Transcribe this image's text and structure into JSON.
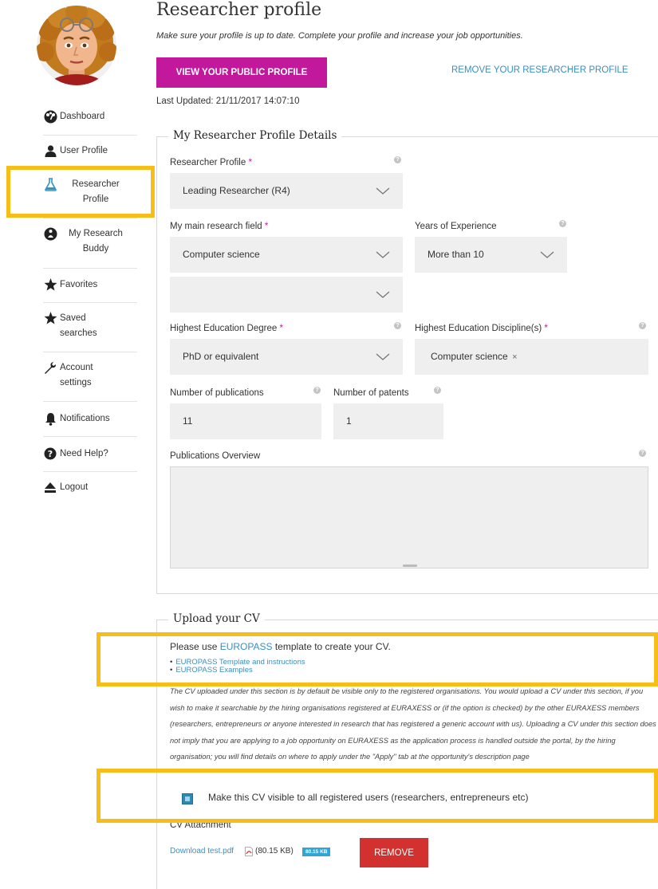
{
  "sidebar": {
    "items": [
      {
        "label": "Dashboard",
        "icon": "dashboard-icon"
      },
      {
        "label": "User Profile",
        "icon": "user-icon"
      },
      {
        "label": "Researcher Profile",
        "icon": "flask-icon"
      },
      {
        "label": "My Research Buddy",
        "icon": "globe-person-icon"
      },
      {
        "label": "Favorites",
        "icon": "star-icon"
      },
      {
        "label": "Saved searches",
        "icon": "star-icon"
      },
      {
        "label": "Account settings",
        "icon": "wrench-icon"
      },
      {
        "label": "Notifications",
        "icon": "bell-icon"
      },
      {
        "label": "Need Help?",
        "icon": "question-icon"
      },
      {
        "label": "Logout",
        "icon": "eject-icon"
      }
    ],
    "active": "Researcher Profile"
  },
  "header": {
    "title": "Researcher profile",
    "subtitle": "Make sure your profile is up to date. Complete your profile and increase your job opportunities.",
    "view_public_profile": "VIEW YOUR PUBLIC PROFILE",
    "remove_profile": "REMOVE YOUR RESEARCHER PROFILE",
    "last_updated": "Last Updated: 21/11/2017 14:07:10"
  },
  "details": {
    "legend": "My Researcher Profile Details",
    "researcher_profile": {
      "label": "Researcher Profile",
      "value": "Leading Researcher (R4)"
    },
    "main_field": {
      "label": "My main research field",
      "value": "Computer science",
      "value2": ""
    },
    "years_experience": {
      "label": "Years of Experience",
      "value": "More than 10"
    },
    "education_degree": {
      "label": "Highest Education Degree",
      "value": "PhD or equivalent"
    },
    "education_discipline": {
      "label": "Highest Education Discipline(s)",
      "tag": "Computer science",
      "tag_remove": "×"
    },
    "publications": {
      "label": "Number of publications",
      "value": "11"
    },
    "patents": {
      "label": "Number of patents",
      "value": "1"
    },
    "overview": {
      "label": "Publications Overview",
      "value": ""
    }
  },
  "cv": {
    "legend": "Upload your CV",
    "intro_pre": "Please use ",
    "intro_link": "EUROPASS",
    "intro_post": " template to create your CV.",
    "links": [
      "EUROPASS Template and instructions",
      "EUROPASS Examples"
    ],
    "notice": "The CV uploaded under this section is by default be visible only to the registered organisations. You would upload a CV under this section, if you wish to make it searchable by the hiring organisations registered at EURAXESS or (if the option is checked) by the other EURAXESS members (researchers, entrepreneurs or anyone interested in research that has registered a generic account with us). Uploading a CV under this section does not imply that you are applying to a job opportunity on EURAXESS as the application process is handled outside the portal, by the hiring organisation; you will find details on where to apply under the \"Apply\" tab at the opportunity's description page",
    "visible_checkbox_label": "Make this CV visible to all registered users (researchers, entrepreneurs etc)",
    "visible_checked": true,
    "attachment_label": "CV Attachment",
    "download_link": "Download test.pdf",
    "file_size": "(80.15 KB)",
    "file_badge": "80.15 KB",
    "remove_button": "REMOVE"
  },
  "colors": {
    "primary_button": "#c2189c",
    "link": "#3a8fbf",
    "remove_button": "#d3312f",
    "highlight": "#f7bd18",
    "required": "#c2189c"
  }
}
